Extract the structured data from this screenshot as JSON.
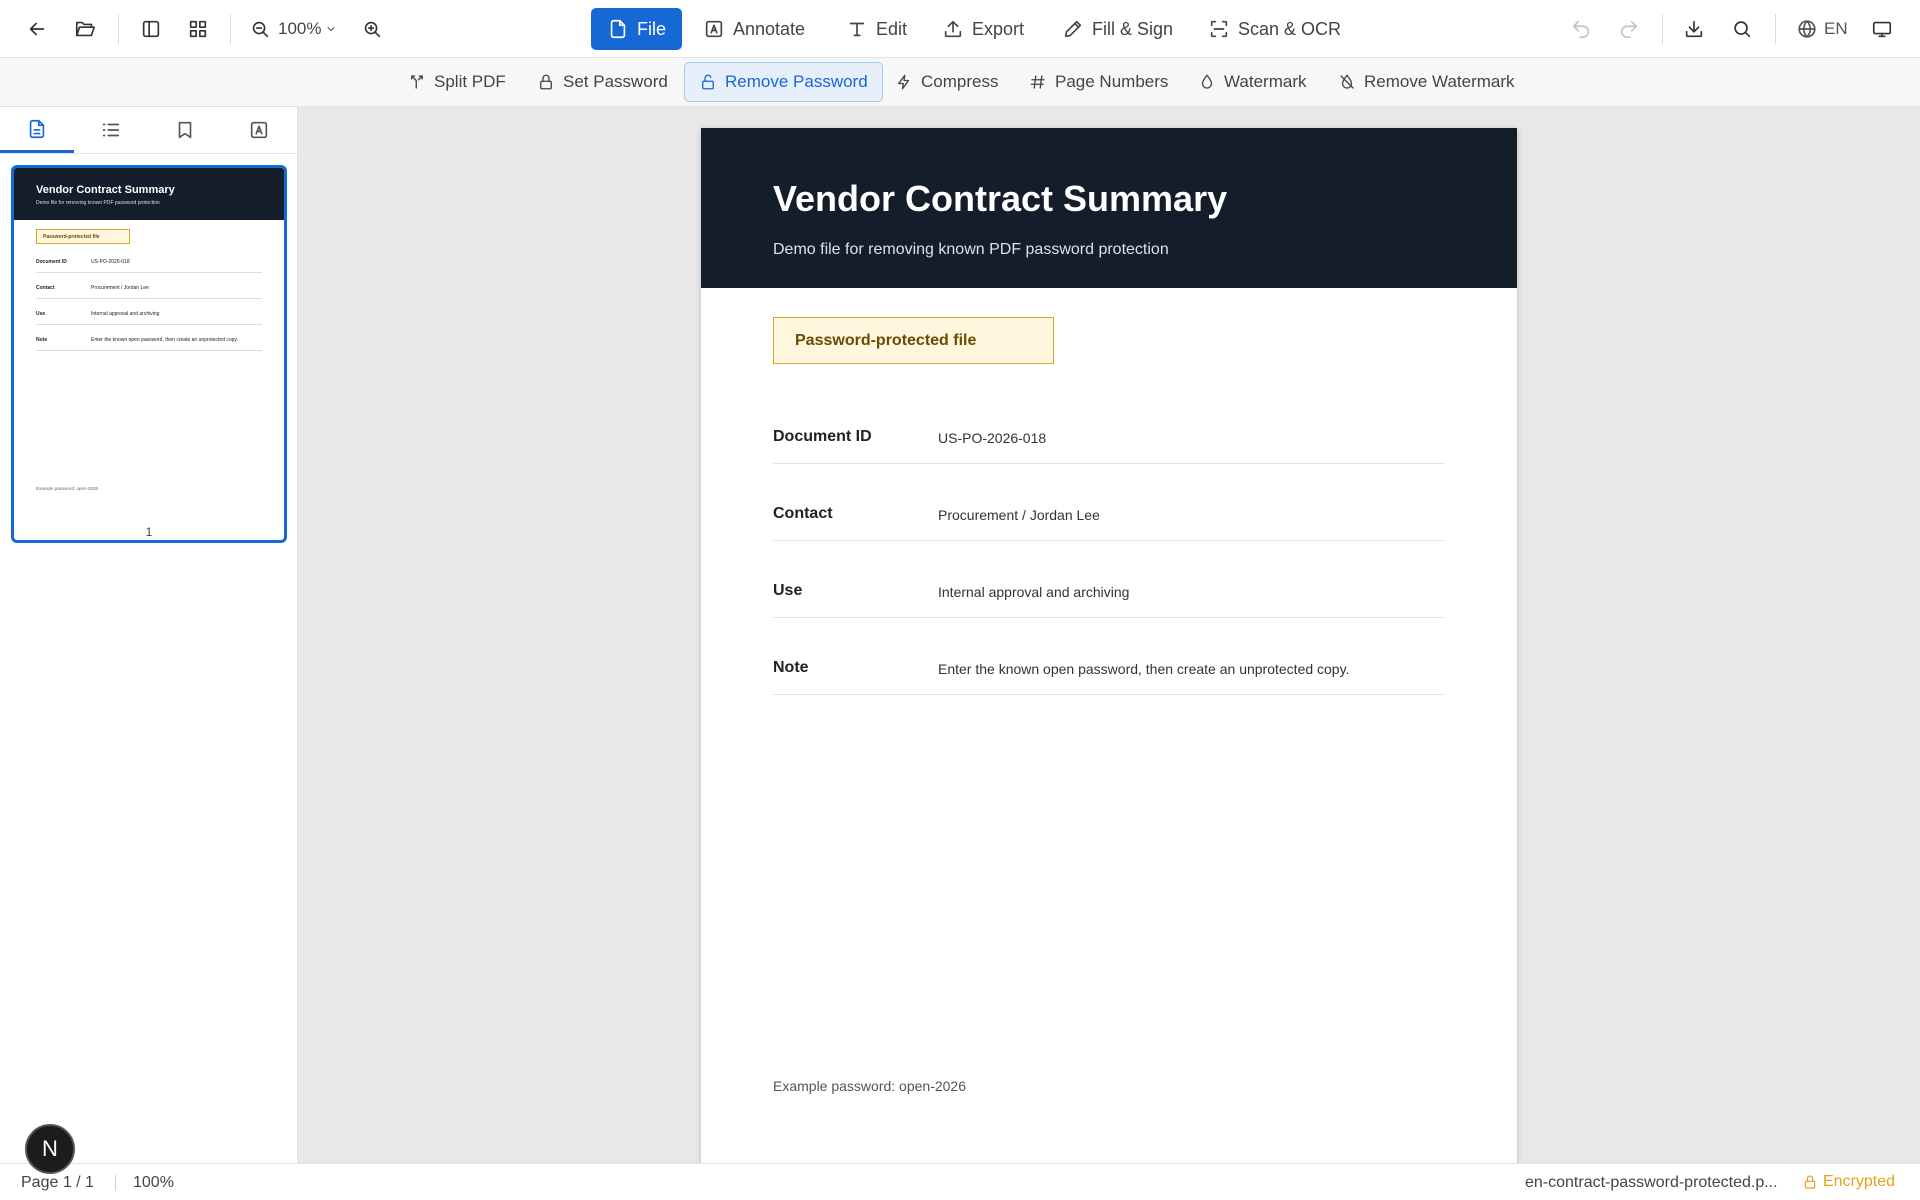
{
  "toolbar": {
    "zoom": "100%",
    "menus": {
      "file": "File",
      "annotate": "Annotate",
      "edit": "Edit",
      "export": "Export",
      "fill_sign": "Fill & Sign",
      "scan_ocr": "Scan & OCR"
    },
    "language": "EN"
  },
  "subtoolbar": {
    "split_pdf": "Split PDF",
    "set_password": "Set Password",
    "remove_password": "Remove Password",
    "compress": "Compress",
    "page_numbers": "Page Numbers",
    "watermark": "Watermark",
    "remove_watermark": "Remove Watermark"
  },
  "document": {
    "title": "Vendor Contract Summary",
    "subtitle": "Demo file for removing known PDF password protection",
    "badge": "Password-protected file",
    "rows": [
      {
        "key": "Document ID",
        "value": "US-PO-2026-018"
      },
      {
        "key": "Contact",
        "value": "Procurement / Jordan Lee"
      },
      {
        "key": "Use",
        "value": "Internal approval and archiving"
      },
      {
        "key": "Note",
        "value": "Enter the known open password, then create an unprotected copy."
      }
    ],
    "footer": "Example password: open-2026"
  },
  "sidebar": {
    "thumbnail_page": "1"
  },
  "status": {
    "page": "Page 1 / 1",
    "zoom": "100%",
    "filename": "en-contract-password-protected.p...",
    "encryption": "Encrypted"
  },
  "fab_label": "N",
  "colors": {
    "accent": "#1668d4",
    "header_dark": "#141e2b",
    "badge_border": "#d7a92a",
    "encrypted": "#e4a31a"
  }
}
